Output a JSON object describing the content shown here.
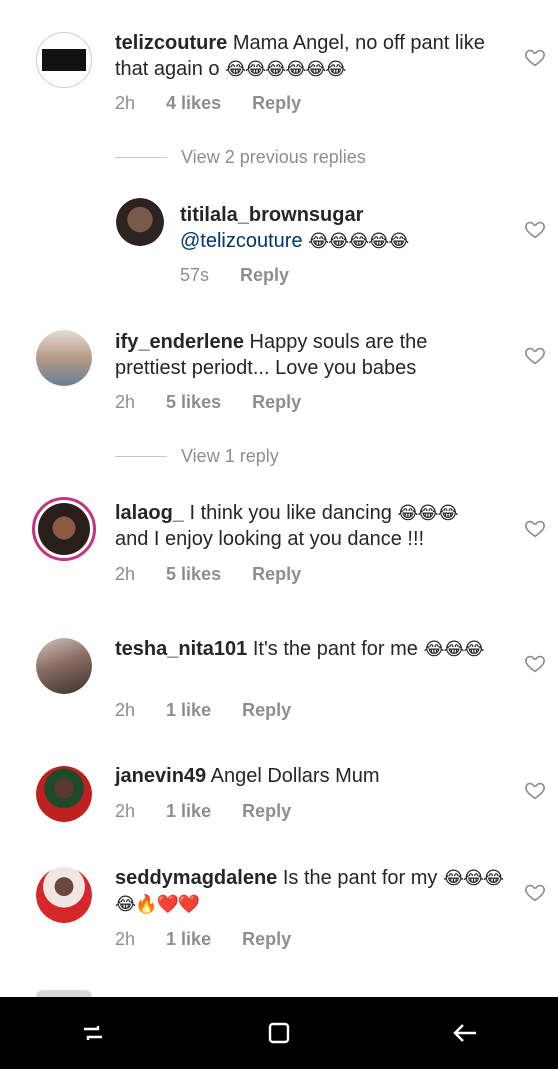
{
  "comments": [
    {
      "user": "telizcouture",
      "text": "Mama Angel, no off pant like that again o",
      "emoji": "😂😂😂😂😂😂",
      "time": "2h",
      "likes": "4 likes",
      "reply": "Reply"
    },
    {
      "user": "titilala_brownsugar",
      "mention": "@telizcouture",
      "emoji": "😂😂😂😂😂",
      "time": "57s",
      "reply": "Reply"
    },
    {
      "user": "ify_enderlene",
      "text": "Happy souls are the prettiest periodt... Love you babes",
      "time": "2h",
      "likes": "5 likes",
      "reply": "Reply"
    },
    {
      "user": "lalaog_",
      "text": "I think you like dancing",
      "emoji": "😂😂😂",
      "text2": "and I enjoy looking at you dance !!!",
      "time": "2h",
      "likes": "5 likes",
      "reply": "Reply"
    },
    {
      "user": "tesha_nita101",
      "text": "It's the pant for me",
      "emoji": "😂😂😂",
      "time": "2h",
      "likes": "1 like",
      "reply": "Reply"
    },
    {
      "user": "janevin49",
      "text": "Angel Dollars Mum",
      "time": "2h",
      "likes": "1 like",
      "reply": "Reply"
    },
    {
      "user": "seddymagdalene",
      "text": "Is the pant for my",
      "emoji": "😂😂😂😂🔥❤️❤️",
      "time": "2h",
      "likes": "1 like",
      "reply": "Reply"
    }
  ],
  "view_replies": [
    "View 2 previous replies",
    "View 1 reply"
  ]
}
